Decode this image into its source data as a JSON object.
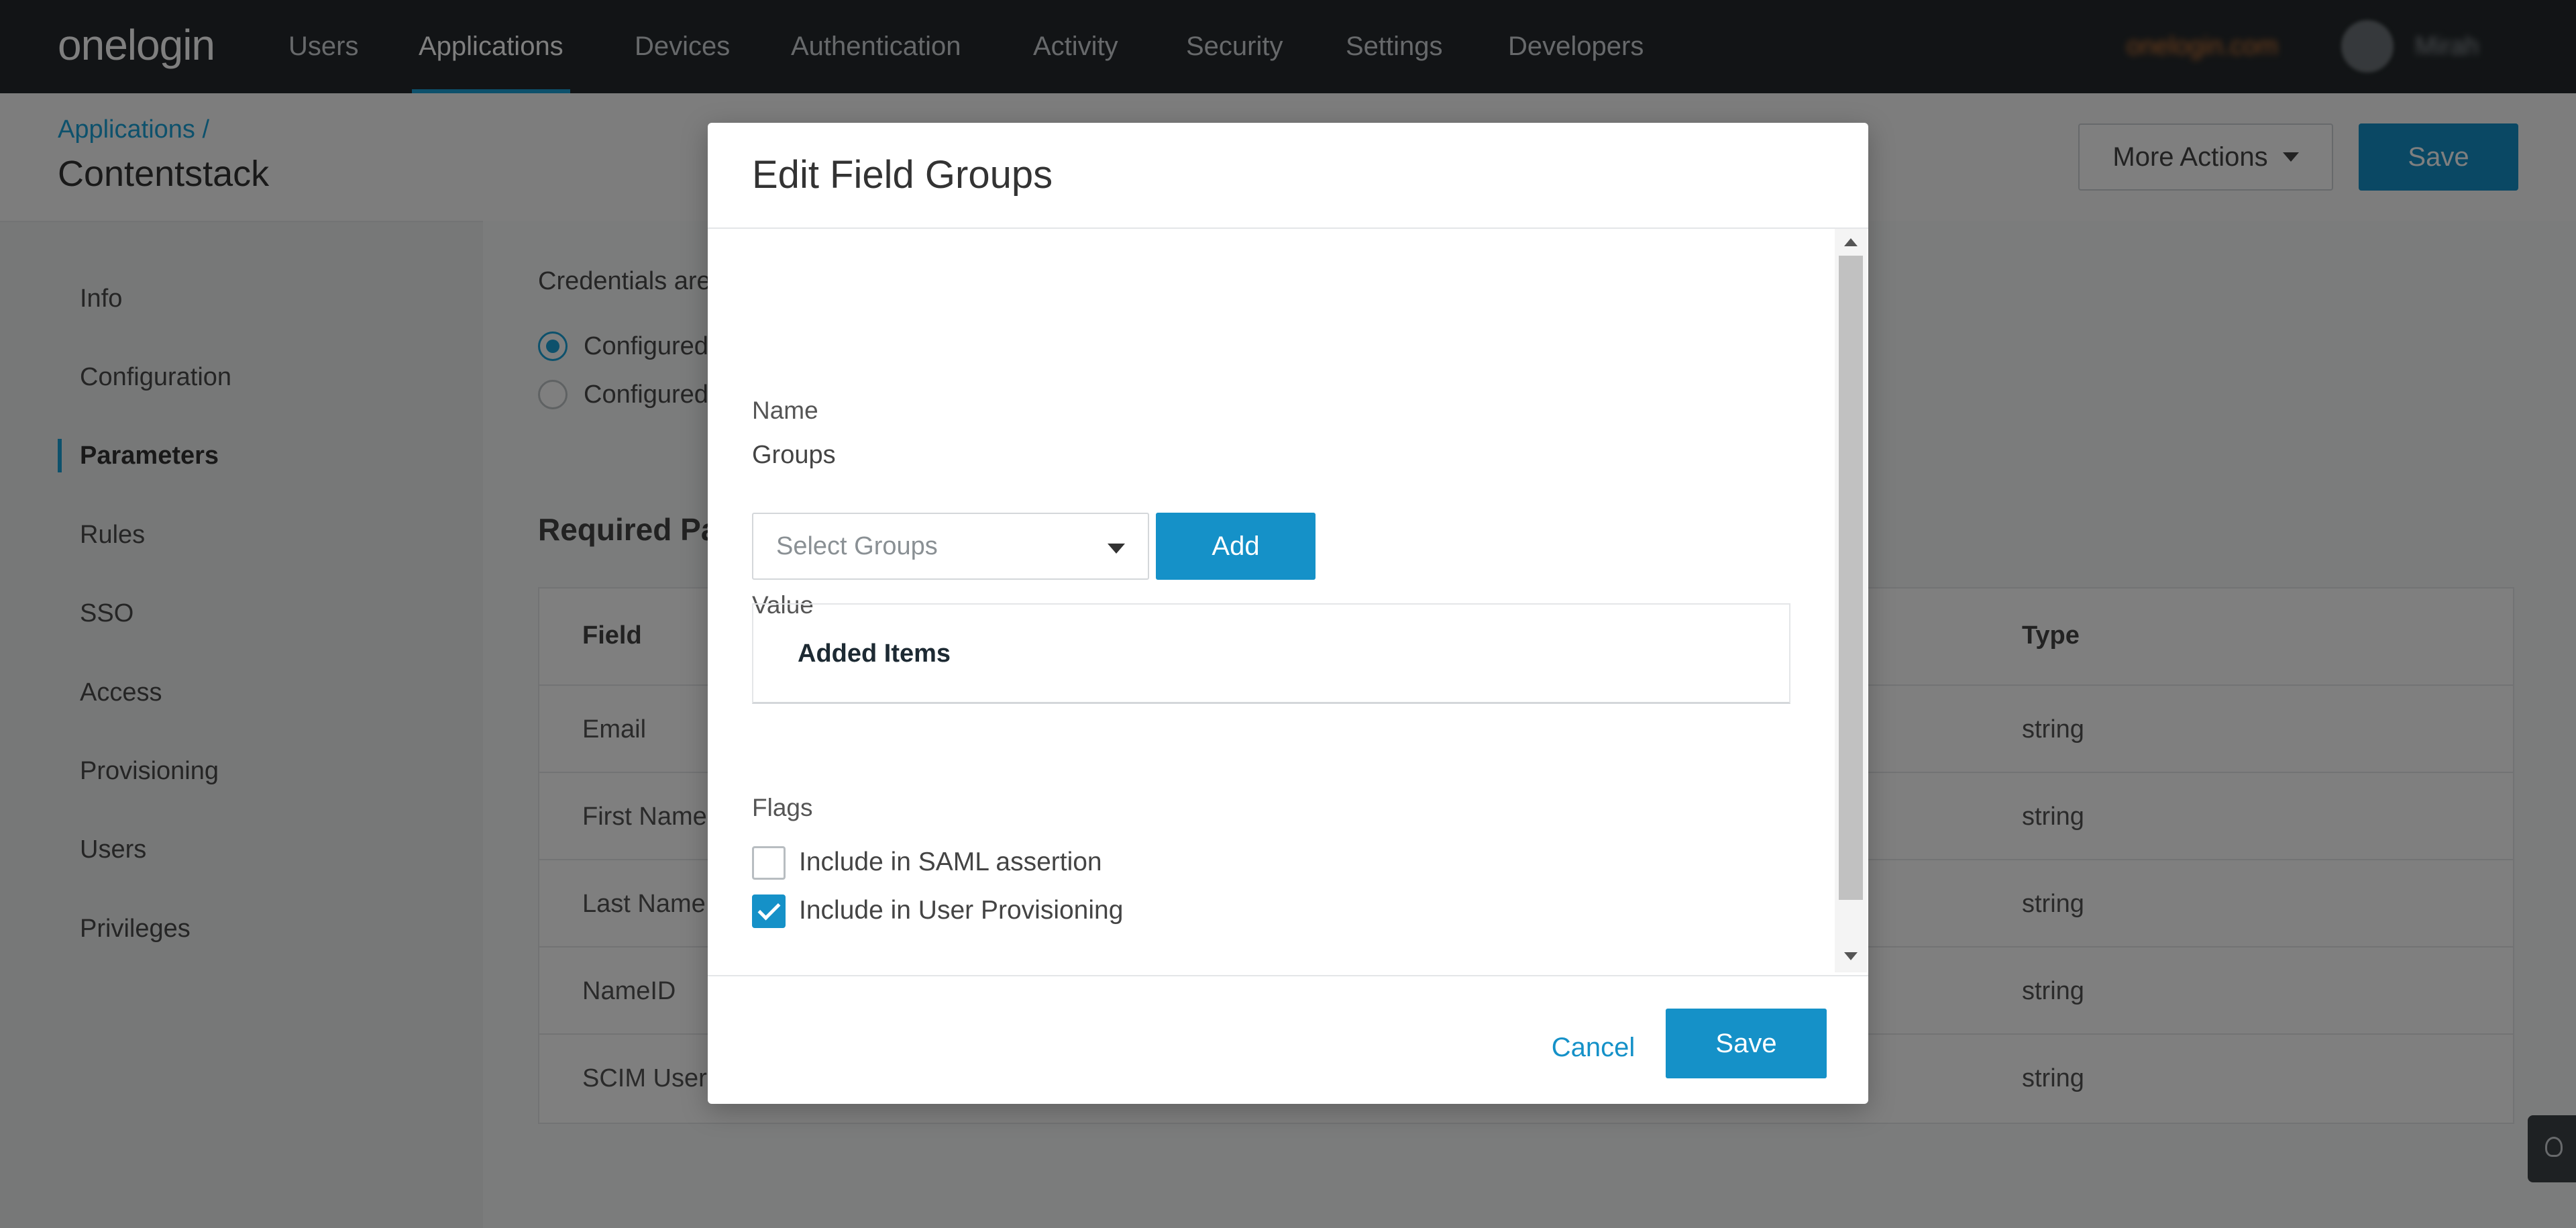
{
  "nav": {
    "logo": "onelogin",
    "items": [
      "Users",
      "Applications",
      "Devices",
      "Authentication",
      "Activity",
      "Security",
      "Settings",
      "Developers"
    ],
    "active": "Applications",
    "brand_link": "onelogin.com",
    "username": "Mirah"
  },
  "header": {
    "breadcrumb": "Applications /",
    "title": "Contentstack",
    "more_actions": "More Actions",
    "save": "Save"
  },
  "sidebar": {
    "items": [
      "Info",
      "Configuration",
      "Parameters",
      "Rules",
      "SSO",
      "Access",
      "Provisioning",
      "Users",
      "Privileges"
    ],
    "active": "Parameters"
  },
  "main": {
    "credentials_text": "Credentials are",
    "radio_options": [
      "Configured",
      "Configured"
    ],
    "required_title": "Required Pa",
    "table": {
      "headers": [
        "Field",
        "Type"
      ],
      "rows": [
        {
          "field": "Email",
          "type": "string"
        },
        {
          "field": "First Name",
          "type": "string"
        },
        {
          "field": "Last Name",
          "type": "string"
        },
        {
          "field": "NameID",
          "type": "string"
        },
        {
          "field": "SCIM Userna",
          "type": "string"
        }
      ]
    }
  },
  "modal": {
    "title": "Edit Field Groups",
    "name_label": "Name",
    "name_value": "Groups",
    "value_label": "Value",
    "select_placeholder": "Select Groups",
    "add_button": "Add",
    "added_items_title": "Added Items",
    "flags_label": "Flags",
    "flags": [
      {
        "label": "Include in SAML assertion",
        "checked": false
      },
      {
        "label": "Include in User Provisioning",
        "checked": true
      }
    ],
    "cancel": "Cancel",
    "save": "Save"
  },
  "colors": {
    "accent": "#1591c8",
    "nav_bg": "#24292c",
    "nav_underline": "#1aa3d8"
  }
}
